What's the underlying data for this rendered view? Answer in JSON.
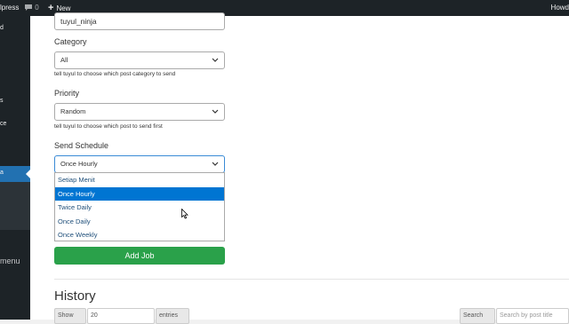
{
  "admin_bar": {
    "site_name": "lpress",
    "comment_count": "0",
    "new_label": "New",
    "howdy": "Howd"
  },
  "sidebar": {
    "items": [
      {
        "label": "d"
      },
      {
        "label": "s"
      },
      {
        "label": "ce"
      }
    ],
    "active_label": "a",
    "collapse_label": "menu"
  },
  "form": {
    "job_name_value": "tuyul_ninja",
    "category": {
      "label": "Category",
      "selected": "All",
      "hint": "tell tuyul to choose which post category to send"
    },
    "priority": {
      "label": "Priority",
      "selected": "Random",
      "hint": "tell tuyul to choose which post to send first"
    },
    "schedule": {
      "label": "Send Schedule",
      "selected": "Once Hourly",
      "options": [
        "Setiap Menit",
        "Once Hourly",
        "Twice Daily",
        "Once Daily",
        "Once Weekly"
      ],
      "highlighted": "Once Hourly"
    },
    "add_job_label": "Add Job"
  },
  "history": {
    "title": "History",
    "show_label": "Show",
    "entries_value": "20",
    "entries_label": "entries",
    "search_label": "Search",
    "search_placeholder": "Search by post title"
  },
  "colors": {
    "admin_bar_bg": "#1d2327",
    "active_menu": "#2271b1",
    "add_button": "#2aa14a",
    "highlight_option": "#0075d2"
  }
}
